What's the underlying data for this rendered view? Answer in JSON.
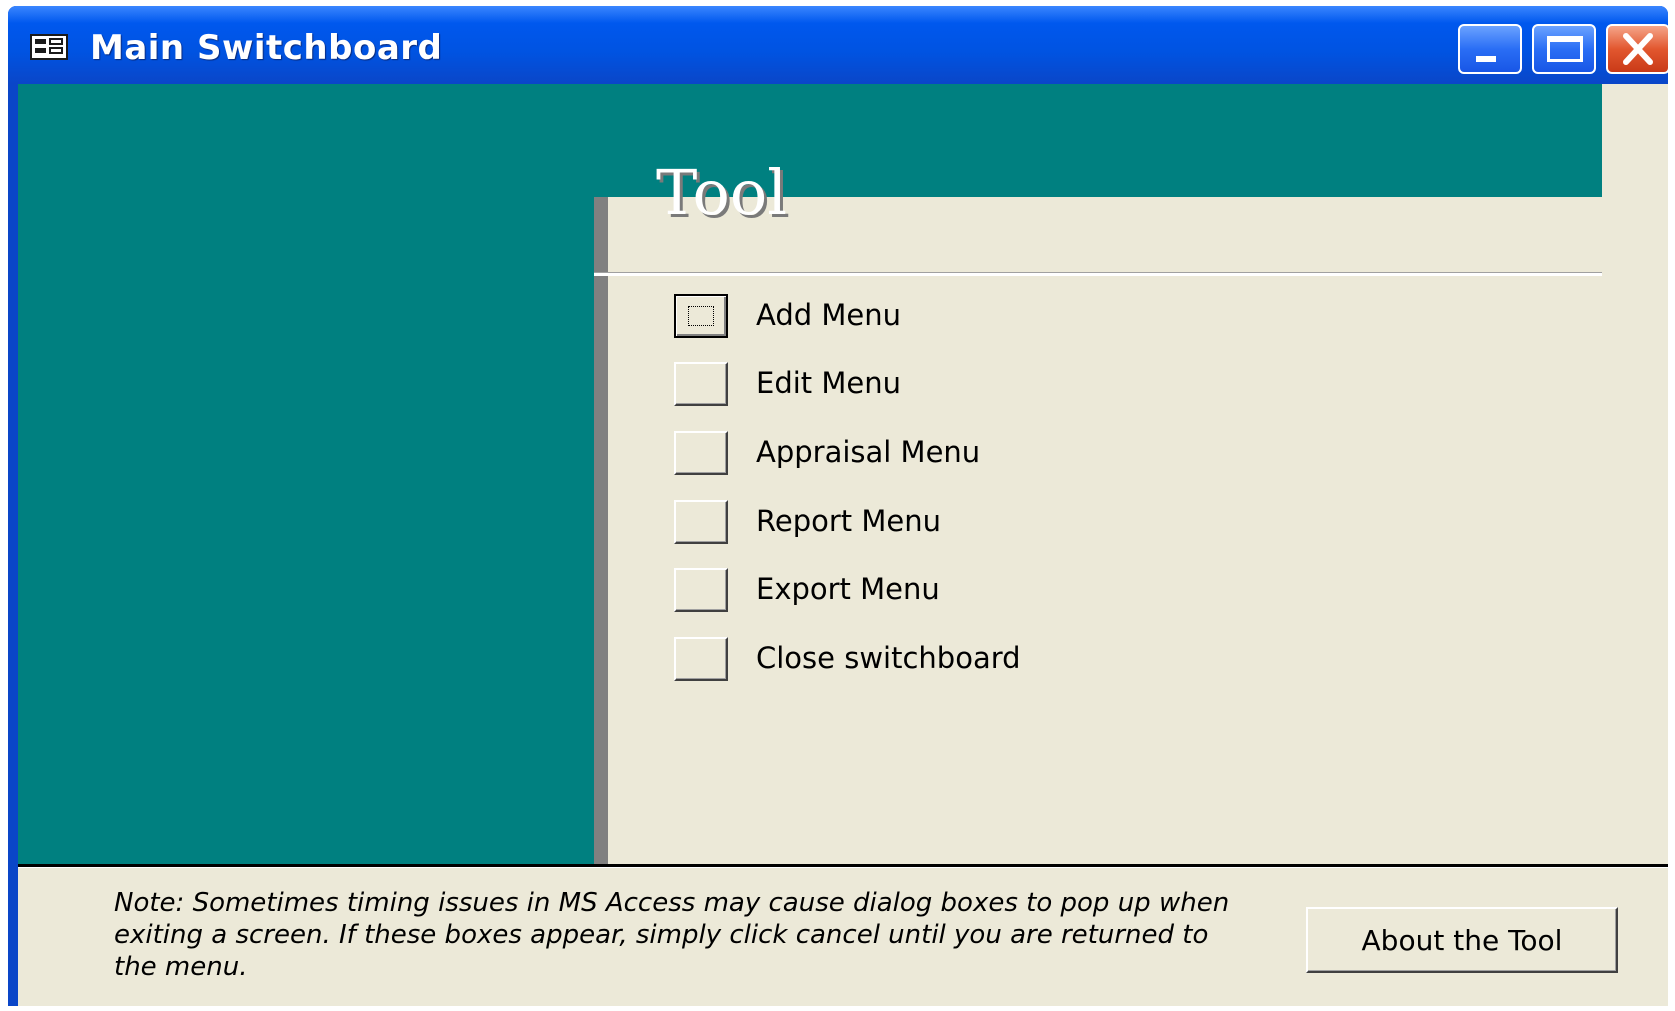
{
  "window": {
    "title": "Main Switchboard",
    "icon": "form-icon"
  },
  "heading": "Tool",
  "menu": {
    "items": [
      {
        "label": "Add Menu",
        "focused": true
      },
      {
        "label": "Edit Menu",
        "focused": false
      },
      {
        "label": "Appraisal Menu",
        "focused": false
      },
      {
        "label": "Report Menu",
        "focused": false
      },
      {
        "label": "Export Menu",
        "focused": false
      },
      {
        "label": "Close switchboard",
        "focused": false
      }
    ]
  },
  "footer": {
    "note": "Note: Sometimes timing issues in MS Access may cause dialog boxes to pop up when exiting a screen. If these boxes appear, simply click cancel until you are returned to the menu.",
    "about_label": "About the Tool"
  },
  "colors": {
    "titlebar": "#0058ee",
    "teal": "#008080",
    "face": "#ece9d8"
  }
}
